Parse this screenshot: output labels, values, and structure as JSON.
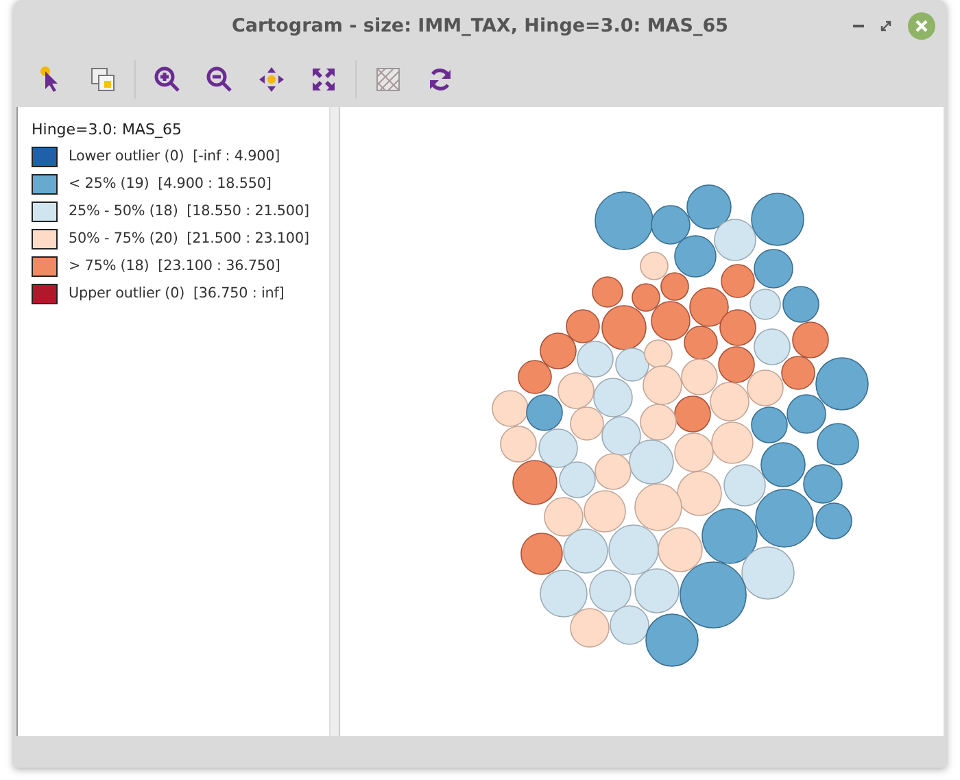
{
  "window": {
    "title": "Cartogram - size: IMM_TAX, Hinge=3.0: MAS_65"
  },
  "legend": {
    "title": "Hinge=3.0: MAS_65",
    "items": [
      {
        "label": "Lower outlier (0)  [-inf : 4.900]",
        "color": "#2060a8"
      },
      {
        "label": "< 25% (19)  [4.900 : 18.550]",
        "color": "#67a9cf"
      },
      {
        "label": "25% - 50% (18)  [18.550 : 21.500]",
        "color": "#d1e5f0"
      },
      {
        "label": "50% - 75% (20)  [21.500 : 23.100]",
        "color": "#fddbc7"
      },
      {
        "label": "> 75% (18)  [23.100 : 36.750]",
        "color": "#ef8a62"
      },
      {
        "label": "Upper outlier (0)  [36.750 : inf]",
        "color": "#b2182b"
      }
    ]
  }
}
